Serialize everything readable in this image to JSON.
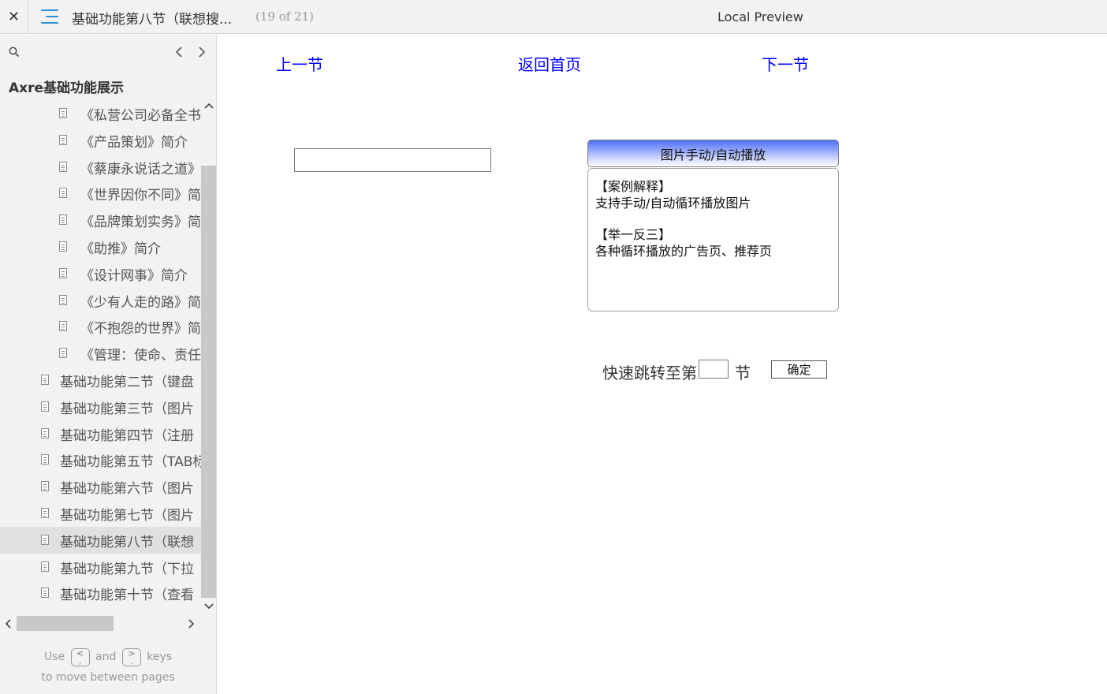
{
  "topbar": {
    "close_label": "✕",
    "page_title": "基础功能第八节（联想搜...",
    "page_count": "(19 of 21)",
    "preview_title": "Local Preview"
  },
  "sidebar": {
    "project_title": "Axre基础功能展示",
    "items": [
      {
        "label": "《私营公司必备全书》",
        "level": 2
      },
      {
        "label": "《产品策划》简介",
        "level": 2
      },
      {
        "label": "《蔡康永说话之道》",
        "level": 2
      },
      {
        "label": "《世界因你不同》简介",
        "level": 2
      },
      {
        "label": "《品牌策划实务》简介",
        "level": 2
      },
      {
        "label": "《助推》简介",
        "level": 2
      },
      {
        "label": "《设计网事》简介",
        "level": 2
      },
      {
        "label": "《少有人走的路》简介",
        "level": 2
      },
      {
        "label": "《不抱怨的世界》简介",
        "level": 2
      },
      {
        "label": "《管理：使命、责任》",
        "level": 2
      },
      {
        "label": "基础功能第二节（键盘",
        "level": 1
      },
      {
        "label": "基础功能第三节（图片",
        "level": 1
      },
      {
        "label": "基础功能第四节（注册",
        "level": 1
      },
      {
        "label": "基础功能第五节（TAB标",
        "level": 1
      },
      {
        "label": "基础功能第六节（图片",
        "level": 1
      },
      {
        "label": "基础功能第七节（图片",
        "level": 1
      },
      {
        "label": "基础功能第八节（联想",
        "level": 1,
        "selected": true
      },
      {
        "label": "基础功能第九节（下拉",
        "level": 1
      },
      {
        "label": "基础功能第十节（查看",
        "level": 1
      }
    ],
    "hint": {
      "use": "Use",
      "key_prev": "<\n,",
      "and": "and",
      "key_next": ">\n.",
      "keys": "keys",
      "line2": "to move between pages"
    }
  },
  "main": {
    "prev_label": "上一节",
    "home_label": "返回首页",
    "next_label": "下一节",
    "input_value": "",
    "panel": {
      "title": "图片手动/自动播放",
      "line1": "【案例解释】",
      "line2": "支持手动/自动循环播放图片",
      "line3": "【举一反三】",
      "line4": "各种循环播放的广告页、推荐页"
    },
    "jump": {
      "label": "快速跳转至第",
      "value": "",
      "unit": "节",
      "confirm": "确定"
    }
  },
  "colors": {
    "link": "#0000ff",
    "accent": "#2d8fd8",
    "selected_row": "#e0e0e0"
  }
}
